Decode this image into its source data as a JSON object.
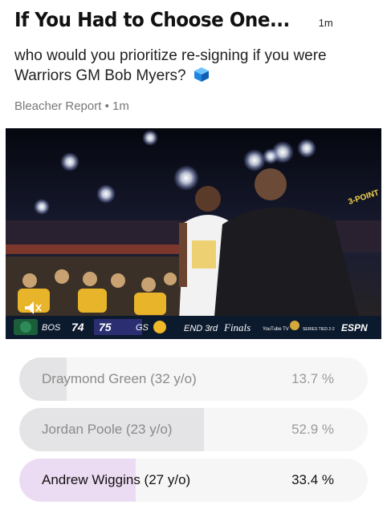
{
  "header": {
    "title": "If You Had to Choose One...",
    "time": "1m"
  },
  "question": {
    "text": "who would you prioritize re-signing if you were Warriors GM Bob Myers?",
    "emoji_icon": "blue-cube-icon"
  },
  "source": {
    "name": "Bleacher Report",
    "separator": "•",
    "time": "1m"
  },
  "video": {
    "muted_icon": "mute-icon",
    "scoreboard": {
      "team_away": "BOS",
      "score_away": "74",
      "score_home": "75",
      "team_home": "GS",
      "period": "END 3rd",
      "brand": "Finals",
      "sponsor": "YouTube TV",
      "series": "SERIES TIED 2-2",
      "network": "ESPN"
    },
    "overlay_text": "3-POINT"
  },
  "poll": {
    "colors": {
      "fill": "#e4e4e6",
      "selected_fill": "#ecdcf3"
    },
    "options": [
      {
        "label": "Draymond Green (32 y/o)",
        "percent_text": "13.7 %",
        "percent": 13.7,
        "selected": false
      },
      {
        "label": "Jordan Poole (23 y/o)",
        "percent_text": "52.9 %",
        "percent": 52.9,
        "selected": false
      },
      {
        "label": "Andrew Wiggins (27 y/o)",
        "percent_text": "33.4 %",
        "percent": 33.4,
        "selected": true
      }
    ]
  }
}
